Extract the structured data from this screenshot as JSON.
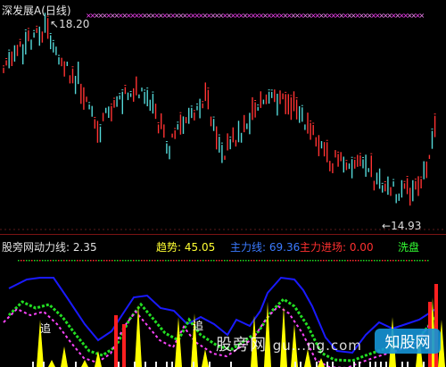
{
  "header": {
    "title": "深发展A(日线)"
  },
  "price_labels": {
    "high": "18.20",
    "low": "14.93"
  },
  "indicator_bar": {
    "source": "股旁网",
    "momentum_label": "动力线: 2.35",
    "trend_label": "趋势: 45.05",
    "main_force_label": "主力线: 69.36",
    "entry_label": "主力进场: 0.00",
    "wash_label": "洗盘"
  },
  "sub_marks": {
    "chase_1": "追",
    "chase_2": "追"
  },
  "watermark": {
    "text": "股旁网",
    "url": "gu...ng.com",
    "logo_text": "知股网"
  },
  "colors": {
    "up": "#ff3232",
    "down": "#54d8d8",
    "blue": "#1a1aff",
    "green": "#22dd22",
    "magenta": "#ff44ff",
    "yellow": "#ffff00",
    "red": "#ff2020",
    "title": "#e8e8e8",
    "trend": "#ffff33",
    "main_force": "#3b7bff",
    "entry": "#ff3030",
    "wash": "#33ff33"
  },
  "chart_data": {
    "type": "candlestick",
    "title": "深发展A(日线)",
    "high": 18.2,
    "low": 14.93,
    "indicators": {
      "momentum": 2.35,
      "trend": 45.05,
      "main_force": 69.36,
      "main_force_entry": 0.0
    }
  }
}
